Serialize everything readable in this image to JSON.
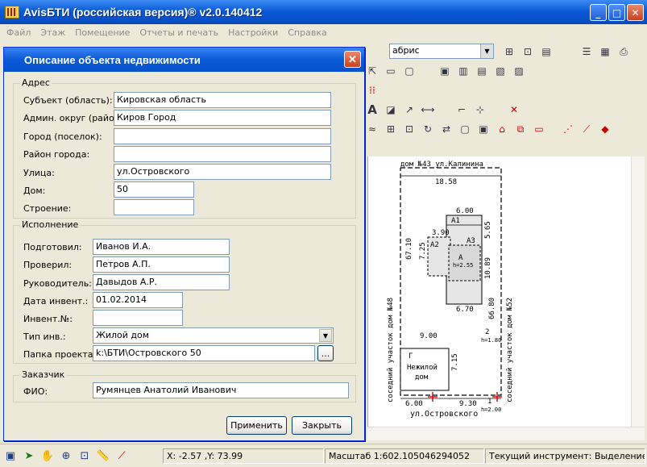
{
  "app": {
    "title": "AvisБТИ (российская версия)® v2.0.140412"
  },
  "menu": [
    "Файл",
    "Этаж",
    "Помещение",
    "Отчеты и печать",
    "Настройки",
    "Справка"
  ],
  "toolbar": {
    "layer_select_value": "абрис"
  },
  "dialog": {
    "title": "Описание объекта недвижимости",
    "address": {
      "legend": "Адрес",
      "fields": [
        {
          "label": "Субъект (область):",
          "value": "Кировская область"
        },
        {
          "label": "Админ. округ (район):",
          "value": "Киров Город"
        },
        {
          "label": "Город (поселок):",
          "value": ""
        },
        {
          "label": "Район города:",
          "value": ""
        },
        {
          "label": "Улица:",
          "value": "ул.Островского"
        },
        {
          "label": "Дом:",
          "value": "50"
        },
        {
          "label": "Строение:",
          "value": ""
        }
      ]
    },
    "execution": {
      "legend": "Исполнение",
      "prepared": {
        "label": "Подготовил:",
        "value": "Иванов И.А."
      },
      "checked": {
        "label": "Проверил:",
        "value": "Петров А.П."
      },
      "manager": {
        "label": "Руководитель:",
        "value": "Давыдов А.Р."
      },
      "inv_date": {
        "label": "Дата инвент.:",
        "value": "01.02.2014"
      },
      "inv_no": {
        "label": "Инвент.№:",
        "value": ""
      },
      "inv_type": {
        "label": "Тип инв.:",
        "value": "Жилой дом"
      },
      "project_folder": {
        "label": "Папка проекта:",
        "value": "k:\\БТИ\\Островского 50",
        "browse": "..."
      }
    },
    "customer": {
      "legend": "Заказчик",
      "fio": {
        "label": "ФИО:",
        "value": "Румянцев Анатолий Иванович"
      }
    },
    "buttons": {
      "apply": "Применить",
      "close": "Закрыть"
    }
  },
  "drawing": {
    "top_label": "дом №43 ул.Калинина",
    "bottom_label": "ул.Островского",
    "left_side_label": "соседний участок дом №48",
    "right_side_label": "соседний участок дом №52",
    "dims": {
      "top": "18.58",
      "left": "67.10",
      "right": "66.80",
      "room_top": "6.00",
      "room_left": "3.90",
      "room_h1": "5.65",
      "room_h2": "10.89",
      "room_v": "7.25",
      "room_bottom": "6.70",
      "nz_top": "9.00",
      "nz_side": "7.15",
      "bottom_left": "6.00",
      "bottom_right": "9.30",
      "h180": "h=1.80",
      "h200": "h=2.00",
      "h255": "h=2.55",
      "corner_1": "1",
      "corner_2": "2"
    },
    "rooms": {
      "a1": "А1",
      "a2": "А2",
      "a3": "А3",
      "a": "А",
      "g": "Г",
      "nz": "Нежилой",
      "nz2": "дом"
    }
  },
  "status": {
    "coords": "X: -2.57 ,Y: 73.99",
    "scale": "Масштаб 1:602.105046294052",
    "tool": "Текущий инструмент: Выделение с"
  }
}
